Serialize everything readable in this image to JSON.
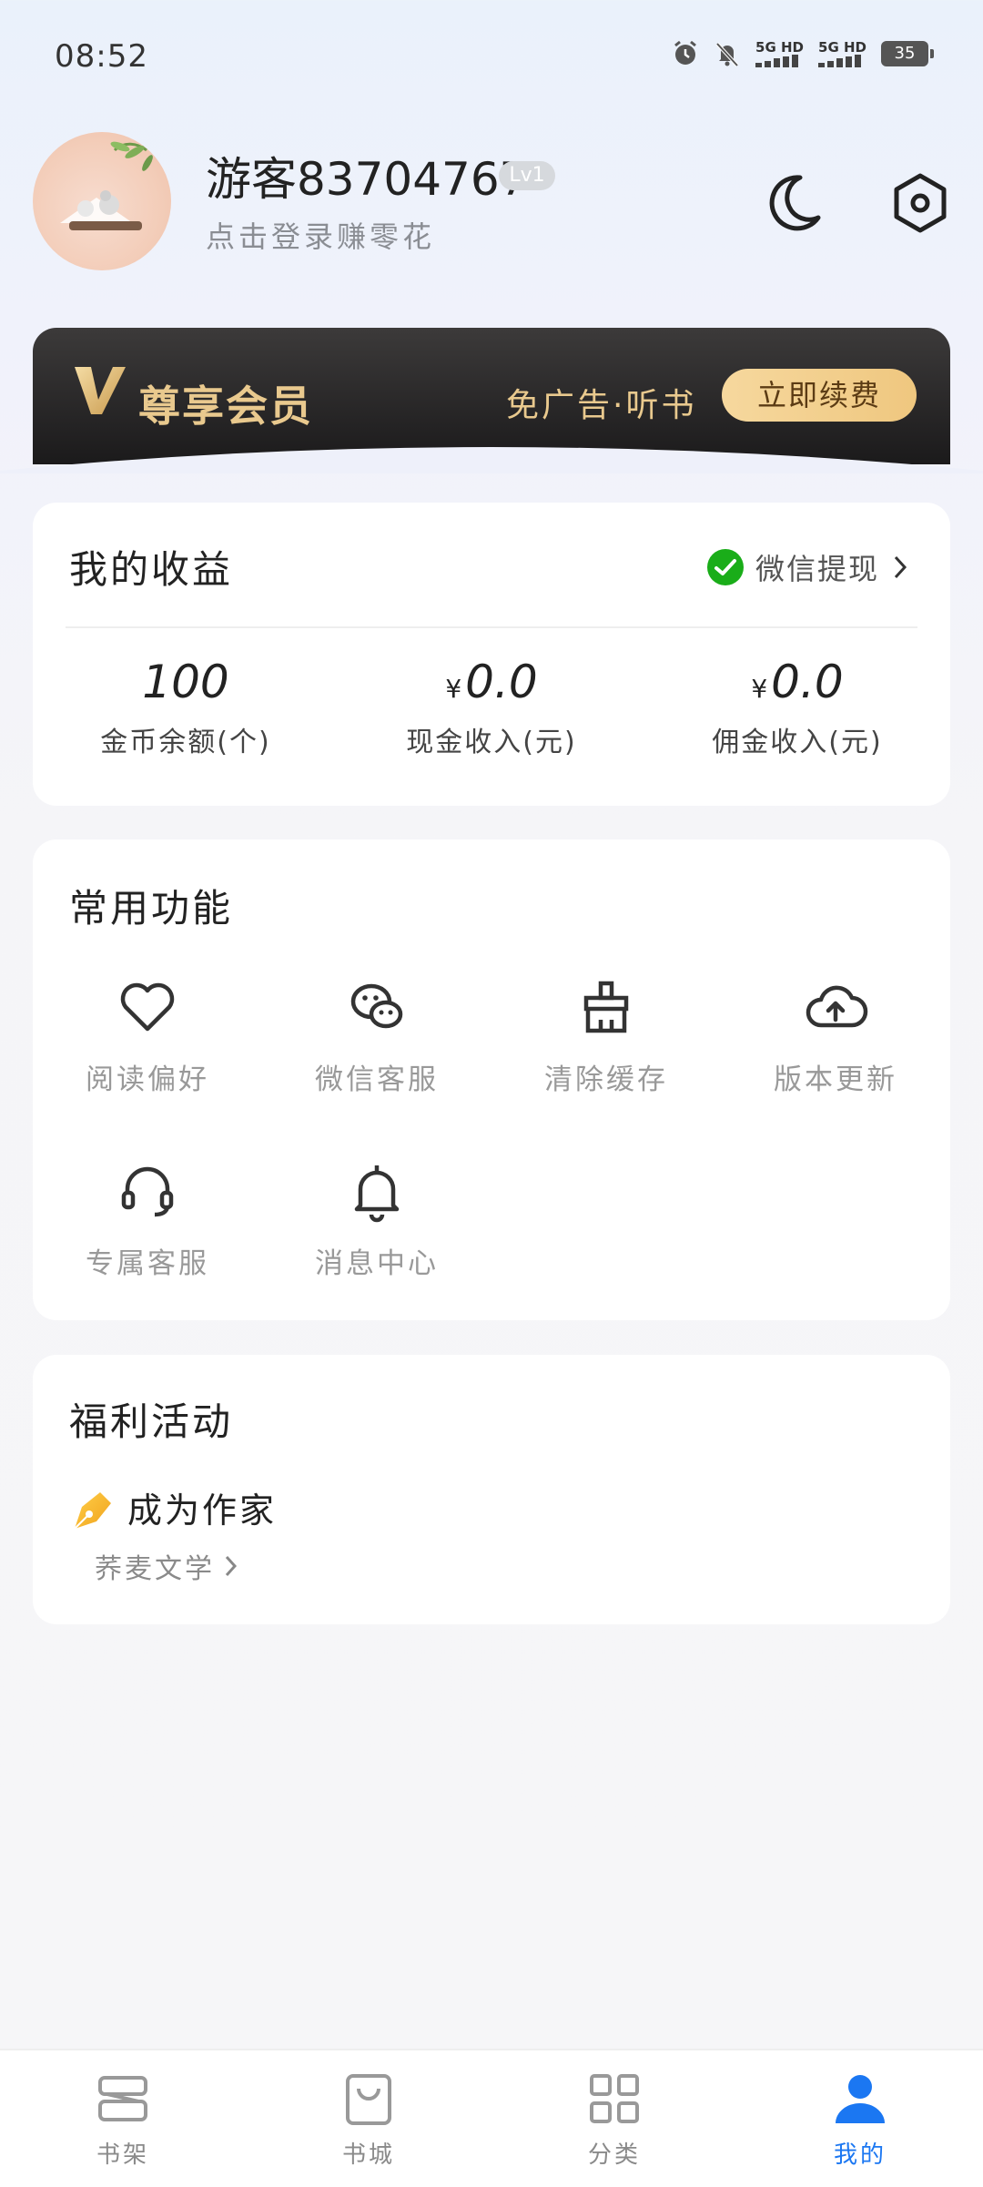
{
  "status_bar": {
    "time": "08:52",
    "network1": "5G HD",
    "network2": "5G HD",
    "battery": "35"
  },
  "profile": {
    "username": "游客83704767",
    "level": "Lv1",
    "login_hint": "点击登录赚零花"
  },
  "vip": {
    "title": "尊享会员",
    "perks": "免广告·听书",
    "renew_button": "立即续费"
  },
  "earnings": {
    "title": "我的收益",
    "withdraw_label": "微信提现",
    "currency_symbol": "¥",
    "items": [
      {
        "value": "100",
        "label": "金币余额(个)"
      },
      {
        "value": "0.0",
        "label": "现金收入(元)"
      },
      {
        "value": "0.0",
        "label": "佣金收入(元)"
      }
    ]
  },
  "functions": {
    "title": "常用功能",
    "items": [
      {
        "label": "阅读偏好",
        "icon": "heart-icon"
      },
      {
        "label": "微信客服",
        "icon": "wechat-icon"
      },
      {
        "label": "清除缓存",
        "icon": "broom-icon"
      },
      {
        "label": "版本更新",
        "icon": "cloud-upload-icon"
      },
      {
        "label": "专属客服",
        "icon": "headset-icon"
      },
      {
        "label": "消息中心",
        "icon": "bell-icon"
      }
    ]
  },
  "welfare": {
    "title": "福利活动",
    "author_title": "成为作家",
    "author_link": "荞麦文学"
  },
  "nav": {
    "active_color": "#1b77f2",
    "items": [
      {
        "label": "书架",
        "icon": "bookshelf-icon"
      },
      {
        "label": "书城",
        "icon": "bookstore-icon"
      },
      {
        "label": "分类",
        "icon": "category-icon"
      },
      {
        "label": "我的",
        "icon": "profile-icon"
      }
    ]
  }
}
